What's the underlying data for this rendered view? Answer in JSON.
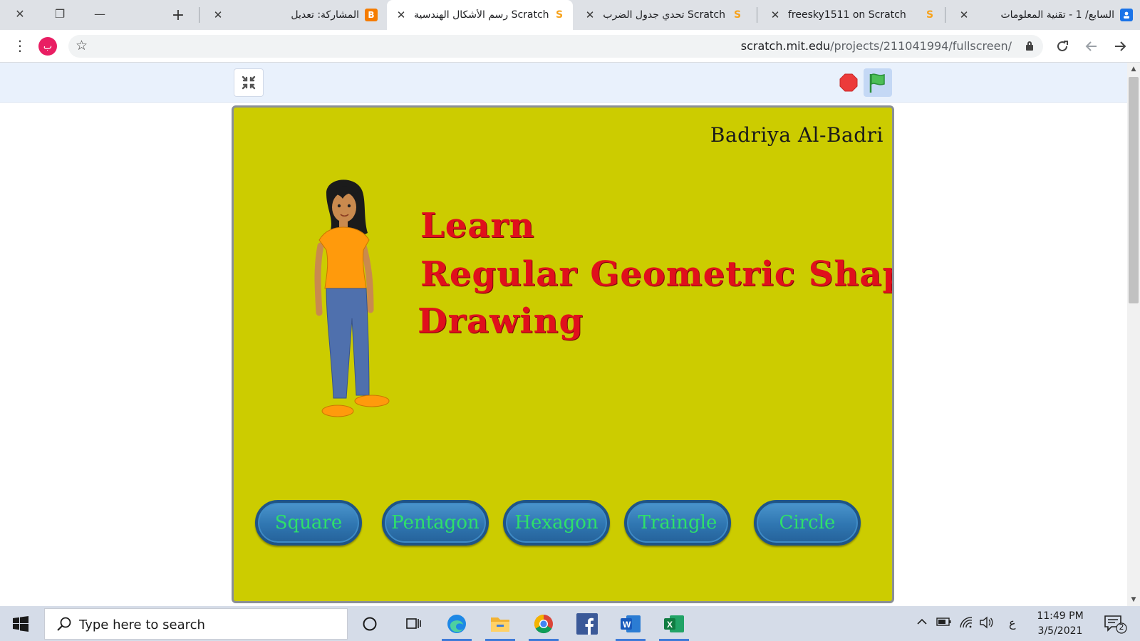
{
  "browser": {
    "window_controls": {
      "close": "✕",
      "restore": "❐",
      "minimize": "—"
    },
    "new_tab": "+",
    "tabs": [
      {
        "title": "السابع/ 1 - تقنية المعلومات",
        "icon": "classroom-icon",
        "active": false
      },
      {
        "title": "freesky1511 on Scratch",
        "icon": "scratch-icon",
        "active": false
      },
      {
        "title": "تحدي جدول الضرب Scratch",
        "icon": "scratch-icon",
        "active": false
      },
      {
        "title": "رسم الأشكال الهندسية Scratch",
        "icon": "scratch-icon",
        "active": true
      },
      {
        "title": "المشاركة: تعديل",
        "icon": "blogger-icon",
        "active": false
      }
    ],
    "profile_initial": "ب",
    "url_host": "scratch.mit.edu",
    "url_path": "/projects/211041994/fullscreen/",
    "colors": {
      "tabstrip": "#dee1e6",
      "profile": "#e91e63"
    }
  },
  "stage": {
    "author": "Badriya Al-Badri",
    "headline": [
      "Learn",
      "Regular Geometric Shapes",
      "Drawing"
    ],
    "buttons": [
      "Square",
      "Pentagon",
      "Hexagon",
      "Traingle",
      "Circle"
    ],
    "colors": {
      "background": "#cccc00",
      "headline": "#e0101c",
      "button": "#2f76b1",
      "button_text": "#2ee06a"
    }
  },
  "taskbar": {
    "search_placeholder": "Type here to search",
    "apps": [
      "cortana-icon",
      "task-view-icon",
      "edge-icon",
      "file-explorer-icon",
      "chrome-icon",
      "facebook-icon",
      "word-icon",
      "excel-icon"
    ],
    "input_language": "ع",
    "time": "11:49 PM",
    "date": "3/5/2021",
    "notification_count": "2"
  }
}
